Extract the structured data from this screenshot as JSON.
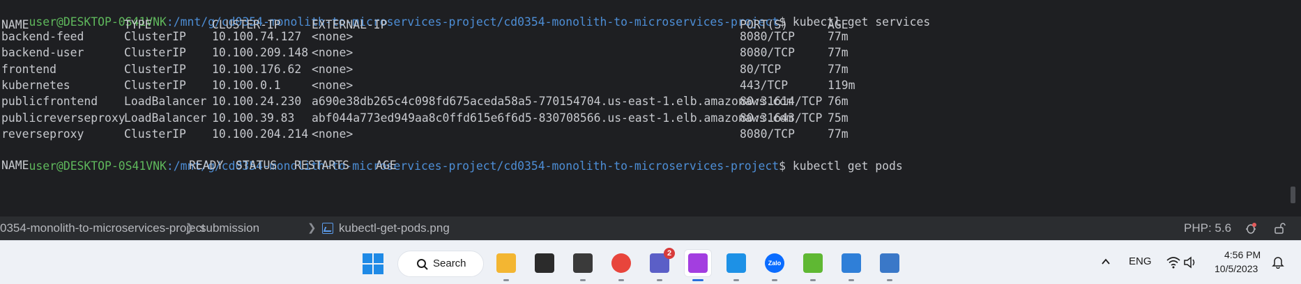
{
  "terminal": {
    "prompt1": {
      "user": "user@DESKTOP-0S41VNK",
      "path": ":/mnt/g/cd0354-monolith-to-microservices-project/cd0354-monolith-to-microservices-project",
      "symbol": "$",
      "command": " kubectl get services"
    },
    "services_headers": [
      "NAME",
      "TYPE",
      "CLUSTER-IP",
      "EXTERNAL-IP",
      "PORT(S)",
      "AGE"
    ],
    "services_rows": [
      [
        "backend-feed",
        "ClusterIP",
        "10.100.74.127",
        "<none>",
        "8080/TCP",
        "77m"
      ],
      [
        "backend-user",
        "ClusterIP",
        "10.100.209.148",
        "<none>",
        "8080/TCP",
        "77m"
      ],
      [
        "frontend",
        "ClusterIP",
        "10.100.176.62",
        "<none>",
        "80/TCP",
        "77m"
      ],
      [
        "kubernetes",
        "ClusterIP",
        "10.100.0.1",
        "<none>",
        "443/TCP",
        "119m"
      ],
      [
        "publicfrontend",
        "LoadBalancer",
        "10.100.24.230",
        "a690e38db265c4c098fd675aceda58a5-770154704.us-east-1.elb.amazonaws.com",
        "80:31614/TCP",
        "76m"
      ],
      [
        "publicreverseproxy",
        "LoadBalancer",
        "10.100.39.83",
        "abf044a773ed949aa8c0ffd615e6f6d5-830708566.us-east-1.elb.amazonaws.com",
        "80:31643/TCP",
        "75m"
      ],
      [
        "reverseproxy",
        "ClusterIP",
        "10.100.204.214",
        "<none>",
        "8080/TCP",
        "77m"
      ]
    ],
    "prompt2": {
      "user": "user@DESKTOP-0S41VNK",
      "path": ":/mnt/g/cd0354-monolith-to-microservices-project/cd0354-monolith-to-microservices-project",
      "symbol": "$",
      "command": " kubectl get pods"
    },
    "pods_headers": [
      "NAME",
      "READY",
      "STATUS",
      "RESTARTS",
      "AGE"
    ]
  },
  "statusbar": {
    "breadcrumbs": [
      "0354-monolith-to-microservices-project",
      "submission",
      "kubectl-get-pods.png"
    ],
    "php_version": "PHP: 5.6",
    "icons": [
      "bug-icon",
      "unlock-icon"
    ]
  },
  "taskbar": {
    "search_label": "Search",
    "apps": [
      {
        "name": "file-explorer",
        "color": "#f3b632"
      },
      {
        "name": "command-prompt",
        "color": "#2b2b2b"
      },
      {
        "name": "terminal",
        "color": "#3a3a3a"
      },
      {
        "name": "chrome",
        "color": "#e8453c"
      },
      {
        "name": "teams",
        "color": "#5b5fc7",
        "badge": "2"
      },
      {
        "name": "phpstorm",
        "color": "#a33ee0",
        "active": true
      },
      {
        "name": "docker",
        "color": "#1d91e6"
      },
      {
        "name": "zalo",
        "color": "#0a6cff",
        "label": "Zalo"
      },
      {
        "name": "remote-desktop",
        "color": "#5fb833"
      },
      {
        "name": "notepad",
        "color": "#2f7fd8"
      },
      {
        "name": "network-tool",
        "color": "#3a78c8"
      }
    ],
    "tray": {
      "language": "ENG",
      "time": "4:56 PM",
      "date": "10/5/2023"
    }
  }
}
